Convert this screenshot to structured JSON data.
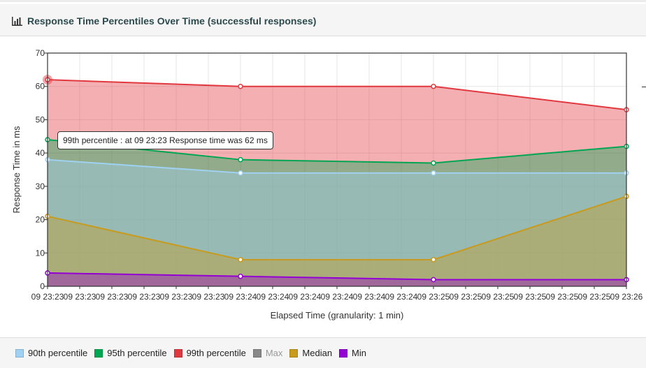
{
  "panel": {
    "icon": "bar-chart-icon",
    "title": "Response Time Percentiles Over Time (successful responses)"
  },
  "tooltip": {
    "text": "99th percentile : at 09 23:23 Response time was 62 ms"
  },
  "legend": [
    {
      "label": "90th percentile",
      "color": "#9fd2f2",
      "enabled": true
    },
    {
      "label": "95th percentile",
      "color": "#00a651",
      "enabled": true
    },
    {
      "label": "99th percentile",
      "color": "#e0383e",
      "enabled": true
    },
    {
      "label": "Max",
      "color": "#888888",
      "enabled": false
    },
    {
      "label": "Median",
      "color": "#c89a1e",
      "enabled": true
    },
    {
      "label": "Min",
      "color": "#9400d3",
      "enabled": true
    }
  ],
  "chart_data": {
    "type": "area",
    "ylabel": "Response Time in ms",
    "xlabel": "Elapsed Time (granularity: 1 min)",
    "ylim": [
      0,
      70
    ],
    "yticks": [
      0,
      10,
      20,
      30,
      40,
      50,
      60,
      70
    ],
    "xlim": [
      "09 23:23",
      "09 23:26"
    ],
    "x_tick_labels": [
      "09 23:23",
      "09 23:23",
      "09 23:23",
      "09 23:23",
      "09 23:23",
      "09 23:23",
      "09 23:24",
      "09 23:24",
      "09 23:24",
      "09 23:24",
      "09 23:24",
      "09 23:24",
      "09 23:25",
      "09 23:25",
      "09 23:25",
      "09 23:25",
      "09 23:25",
      "09 23:25",
      "09 23:26"
    ],
    "x": [
      "09 23:23",
      "09 23:24",
      "09 23:25",
      "09 23:26"
    ],
    "grid": true,
    "series": [
      {
        "name": "99th percentile",
        "color": "#e0383e",
        "values": [
          62,
          60,
          60,
          53
        ]
      },
      {
        "name": "95th percentile",
        "color": "#00a651",
        "values": [
          44,
          38,
          37,
          42
        ]
      },
      {
        "name": "90th percentile",
        "color": "#9fd2f2",
        "values": [
          38,
          34,
          34,
          34
        ]
      },
      {
        "name": "Median",
        "color": "#c89a1e",
        "values": [
          21,
          8,
          8,
          27
        ]
      },
      {
        "name": "Min",
        "color": "#9400d3",
        "values": [
          4,
          3,
          2,
          2
        ]
      }
    ],
    "highlighted_point": {
      "series": "99th percentile",
      "x": "09 23:23",
      "y": 62
    }
  }
}
